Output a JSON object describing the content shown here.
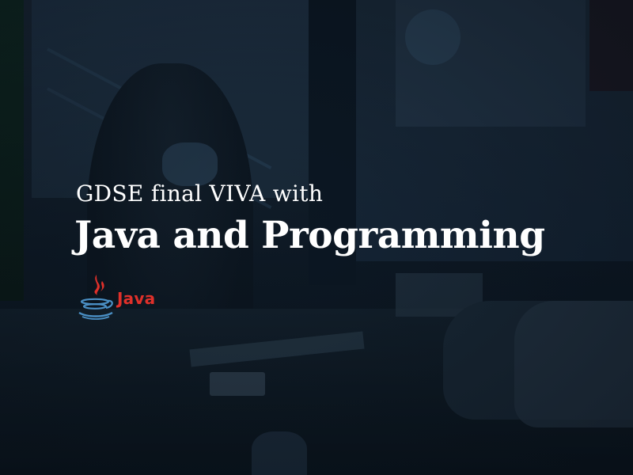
{
  "banner": {
    "subtitle": "GDSE final VIVA with",
    "title": "Java and Programming",
    "logo": {
      "icon": "java-coffee-cup-icon",
      "text": "Java",
      "text_color": "#e0302a",
      "cup_color": "#4a8fc4"
    }
  },
  "colors": {
    "text": "#ffffff",
    "overlay": "#0b1622"
  }
}
